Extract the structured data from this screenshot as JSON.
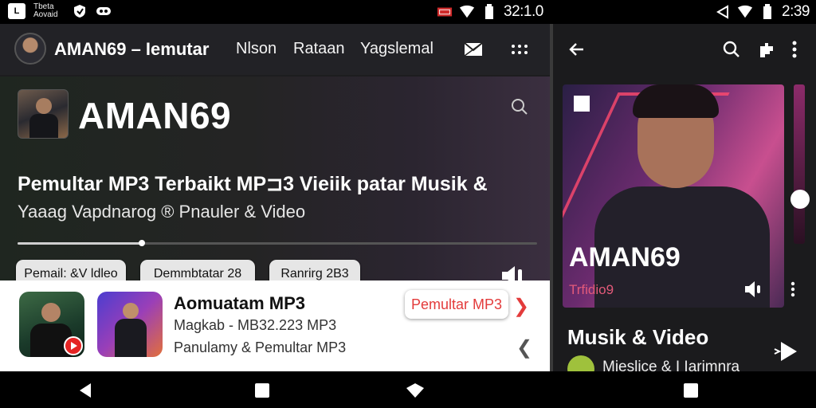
{
  "status_bar": {
    "left_text": "Tbeta Aovaid",
    "clock_left": "32:1.0",
    "clock_right": "2:39"
  },
  "app_bar": {
    "title": "AMAN69 – Iemutar",
    "links": [
      "Nlson",
      "Rataan",
      "Yagslemal"
    ]
  },
  "hero": {
    "title": "AMAN69",
    "subtitle": "Pemultar MP3 Terbaikt MP⊐3 Vieiik patar Musik &",
    "subtitle2": "Yaaag Vapdnarog ® Pnauler & Video",
    "progress": 0.24,
    "chips": [
      "Pemail: &V ldleo",
      "Demmbtatar 28",
      "Ranrirg 2B3"
    ]
  },
  "card": {
    "title": "Aomuatam MP3",
    "line2": "Magkab - MB32.223 MP3",
    "line3": "Panulamy & Pemultar MP3",
    "action_label": "Pemultar MP3"
  },
  "right_panel": {
    "art_title": "AMAN69",
    "art_subtitle": "Trfidio9",
    "section_heading": "Musik & Video",
    "list_item": "Mieslice & I Iarimnra"
  },
  "colors": {
    "accent_red": "#e33b3b",
    "accent_pink": "#e35a7a",
    "dark_bg": "#1d1d1f"
  },
  "icons": [
    "mail-icon",
    "grid-icon",
    "back-arrow-icon",
    "search-icon",
    "puzzle-icon",
    "more-vert-icon",
    "volume-icon",
    "play-icon",
    "youtube-icon"
  ]
}
